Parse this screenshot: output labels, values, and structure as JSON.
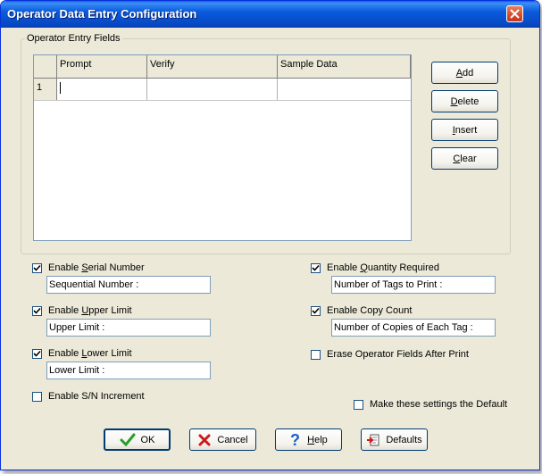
{
  "window": {
    "title": "Operator Data Entry Configuration"
  },
  "group": {
    "label": "Operator Entry Fields"
  },
  "grid": {
    "columns": [
      "Prompt",
      "Verify",
      "Sample Data"
    ],
    "rows": [
      {
        "num": "1",
        "prompt": "",
        "verify": "",
        "sample": ""
      }
    ]
  },
  "side_buttons": {
    "add": {
      "key": "A",
      "rest": "dd"
    },
    "delete": {
      "key": "D",
      "rest": "elete"
    },
    "insert": {
      "key": "I",
      "rest": "nsert"
    },
    "clear": {
      "key": "C",
      "rest": "lear"
    }
  },
  "options": {
    "serial": {
      "pre": "Enable ",
      "key": "S",
      "post": "erial Number",
      "checked": true,
      "field": "Sequential Number :"
    },
    "upper": {
      "pre": "Enable ",
      "key": "U",
      "post": "pper Limit",
      "checked": true,
      "field": "Upper Limit :"
    },
    "lower": {
      "pre": "Enable ",
      "key": "L",
      "post": "ower Limit",
      "checked": true,
      "field": "Lower Limit :"
    },
    "sn_increment": {
      "label": "Enable S/N Increment",
      "checked": false
    },
    "quantity": {
      "pre": "Enable ",
      "key": "Q",
      "post": "uantity Required",
      "checked": true,
      "field": "Number of Tags to Print :"
    },
    "copy": {
      "label": "Enable Copy Count",
      "checked": true,
      "field": "Number of Copies of Each Tag :"
    },
    "erase": {
      "label": "Erase Operator Fields After Print",
      "checked": false
    },
    "default": {
      "label": "Make these settings the Default",
      "checked": false
    }
  },
  "bottom_buttons": {
    "ok": "OK",
    "cancel": "Cancel",
    "help": {
      "key": "H",
      "rest": "elp"
    },
    "defaults": "Defaults"
  },
  "icons": {
    "ok": "checkmark-icon",
    "cancel": "red-x-icon",
    "help": "question-mark-icon",
    "defaults": "document-arrow-icon",
    "close": "close-icon"
  },
  "colors": {
    "titlebar": "#0a5bdc",
    "dialog": "#ece9d8",
    "close": "#d54a2a",
    "ok_check": "#2a9d2a",
    "cancel_x": "#cc1a1a",
    "help_q": "#1a5fcf"
  }
}
